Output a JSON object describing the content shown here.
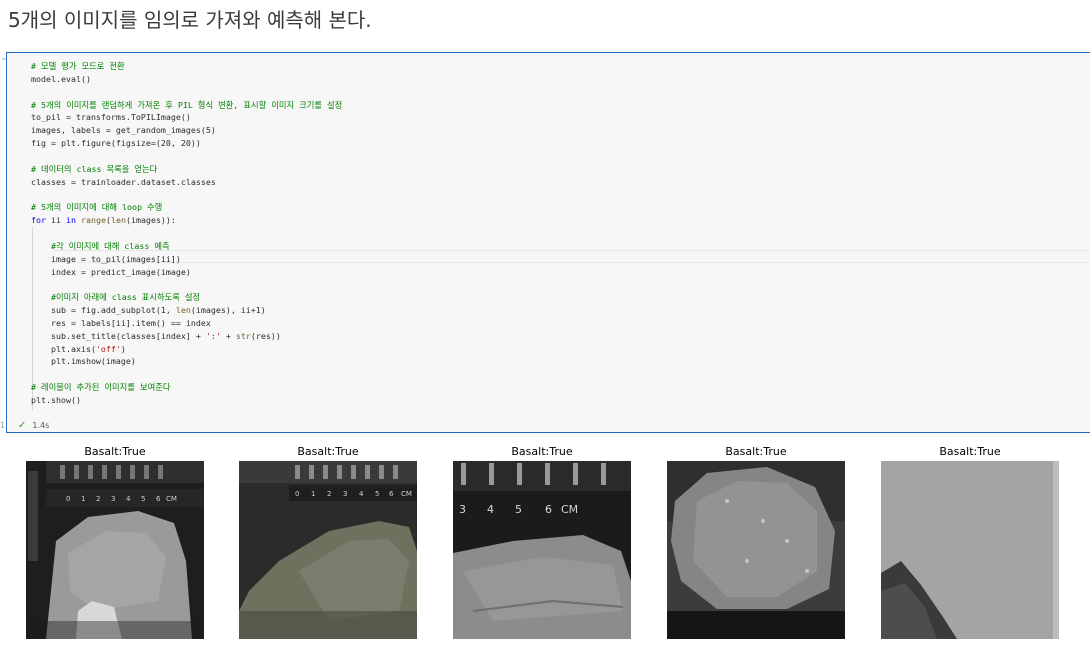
{
  "heading": "5개의 이미지를 임의로 가져와 예측해 본다.",
  "cell": {
    "code_lines": [
      [
        [
          "cm",
          "# 모델 평가 모드로 전환"
        ]
      ],
      [
        [
          "",
          "model.eval()"
        ]
      ],
      [],
      [
        [
          "cm",
          "# 5개의 이미지를 랜덤하게 가져온 후 PIL 형식 변환, 표시할 이미지 크기를 설정"
        ]
      ],
      [
        [
          "",
          "to_pil = transforms.ToPILImage()"
        ]
      ],
      [
        [
          "",
          "images, labels = get_random_images(5)"
        ]
      ],
      [
        [
          "",
          "fig = plt.figure(figsize=(20, 20))"
        ]
      ],
      [],
      [
        [
          "cm",
          "# 데이터의 class 목록을 얻는다"
        ]
      ],
      [
        [
          "",
          "classes = trainloader.dataset.classes"
        ]
      ],
      [],
      [
        [
          "cm",
          "# 5개의 이미지에 대해 loop 수행"
        ]
      ],
      [
        [
          "kw",
          "for"
        ],
        [
          "",
          " ii "
        ],
        [
          "kw",
          "in"
        ],
        [
          "",
          " "
        ],
        [
          "fn",
          "range"
        ],
        [
          "",
          "("
        ],
        [
          "fn",
          "len"
        ],
        [
          "",
          "(images)):"
        ]
      ],
      [],
      [
        [
          "",
          "    "
        ],
        [
          "cm",
          "#각 이미지에 대해 class 예측"
        ]
      ],
      [
        [
          "",
          "    image = to_pil(images[ii])"
        ]
      ],
      [
        [
          "",
          "    index = predict_image(image)"
        ]
      ],
      [],
      [
        [
          "",
          "    "
        ],
        [
          "cm",
          "#이미지 아래에 class 표시하도록 설정"
        ]
      ],
      [
        [
          "",
          "    sub = fig.add_subplot(1, "
        ],
        [
          "fn",
          "len"
        ],
        [
          "",
          "(images), ii+1)"
        ]
      ],
      [
        [
          "",
          "    res = labels[ii].item() == index"
        ]
      ],
      [
        [
          "",
          "    sub.set_title(classes[index] + "
        ],
        [
          "st",
          "':'"
        ],
        [
          "",
          " + "
        ],
        [
          "fn",
          "str"
        ],
        [
          "",
          "(res))"
        ]
      ],
      [
        [
          "",
          "    plt.axis("
        ],
        [
          "st",
          "'off'"
        ],
        [
          "",
          ")"
        ]
      ],
      [
        [
          "",
          "    plt.imshow(image)"
        ]
      ],
      [],
      [
        [
          "cm",
          "# 레이블이 추가된 이미지를 보여준다"
        ]
      ],
      [
        [
          "",
          "plt.show()"
        ]
      ]
    ],
    "status_time": "1.4s",
    "gutter_mark": "1"
  },
  "panels": [
    {
      "title": "Basalt:True",
      "image": "rock-photo-1"
    },
    {
      "title": "Basalt:True",
      "image": "rock-photo-2"
    },
    {
      "title": "Basalt:True",
      "image": "rock-photo-3"
    },
    {
      "title": "Basalt:True",
      "image": "rock-photo-4"
    },
    {
      "title": "Basalt:True",
      "image": "rock-photo-5"
    }
  ],
  "ruler_labels": [
    [
      "0",
      "1",
      "2",
      "3",
      "4",
      "5",
      "6",
      "CM"
    ],
    [
      "0",
      "1",
      "2",
      "3",
      "4",
      "5",
      "6",
      "CM"
    ],
    [
      "3",
      "4",
      "5",
      "6",
      "CM"
    ]
  ],
  "icons": {
    "run_status": "check-icon",
    "collapse": "chevron-down-icon"
  },
  "colors": {
    "cell_border": "#1f6fc2",
    "cell_background": "#f7f7f7",
    "comment": "#008000",
    "keyword": "#0000ff",
    "string": "#a31515"
  }
}
